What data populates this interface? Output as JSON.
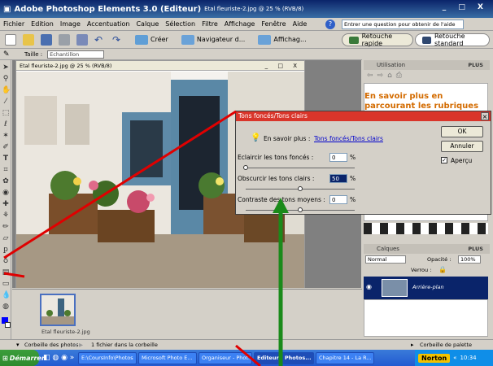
{
  "window": {
    "title": "Adobe Photoshop Elements 3.0 (Editeur)",
    "subtitle": "Etal fleuriste-2.jpg @ 25 % (RVB/8)",
    "controls": "_ □ X"
  },
  "menu": [
    "Fichier",
    "Edition",
    "Image",
    "Accentuation",
    "Calque",
    "Sélection",
    "Filtre",
    "Affichage",
    "Fenêtre",
    "Aide"
  ],
  "help_placeholder": "Entrer une question pour obtenir de l'aide",
  "toolbar": {
    "create": "Créer",
    "navigator": "Navigateur d...",
    "display": "Affichag...",
    "quick_fix": "Retouche rapide",
    "standard_edit": "Retouche standard"
  },
  "options": {
    "size_label": "Taille :",
    "sample_value": "Echantillon ponctuel"
  },
  "document": {
    "title": "Etal fleuriste-2.jpg @ 25 % (RVB/8)",
    "controls": "_ □ X"
  },
  "palettes": {
    "usage": "Utilisation",
    "more": "PLUS",
    "learn_more": "En savoir plus en parcourant les rubriques",
    "layers": "Calques",
    "mode": "Normal",
    "opacity_label": "Opacité :",
    "opacity_value": "100%",
    "lock_label": "Verrou :",
    "layer_name": "Arrière-plan"
  },
  "dialog": {
    "title": "Tons foncés/Tons clairs",
    "learn_prefix": "En savoir plus :",
    "learn_link": "Tons foncés/Tons clairs",
    "lighten_label": "Eclaircir les tons foncés :",
    "lighten_value": "0",
    "darken_label": "Obscurcir les tons clairs :",
    "darken_value": "50",
    "contrast_label": "Contraste des tons moyens :",
    "contrast_value": "0",
    "unit": "%",
    "ok": "OK",
    "cancel": "Annuler",
    "preview": "Aperçu"
  },
  "bin": {
    "thumb_label": "Etal fleuriste-2.jpg"
  },
  "status": {
    "left": "Corbeille des photos",
    "count": "1 fichier dans la corbeille",
    "right": "Corbeille de palette"
  },
  "taskbar": {
    "start": "Démarrer",
    "tasks": [
      "E:\\CoursInfo\\Photos",
      "Microsoft Photo E...",
      "Organiseur - Phot...",
      "Editeur - Photos...",
      "Chapitre 14 - La R..."
    ],
    "norton": "Norton",
    "clock": "10:34"
  }
}
